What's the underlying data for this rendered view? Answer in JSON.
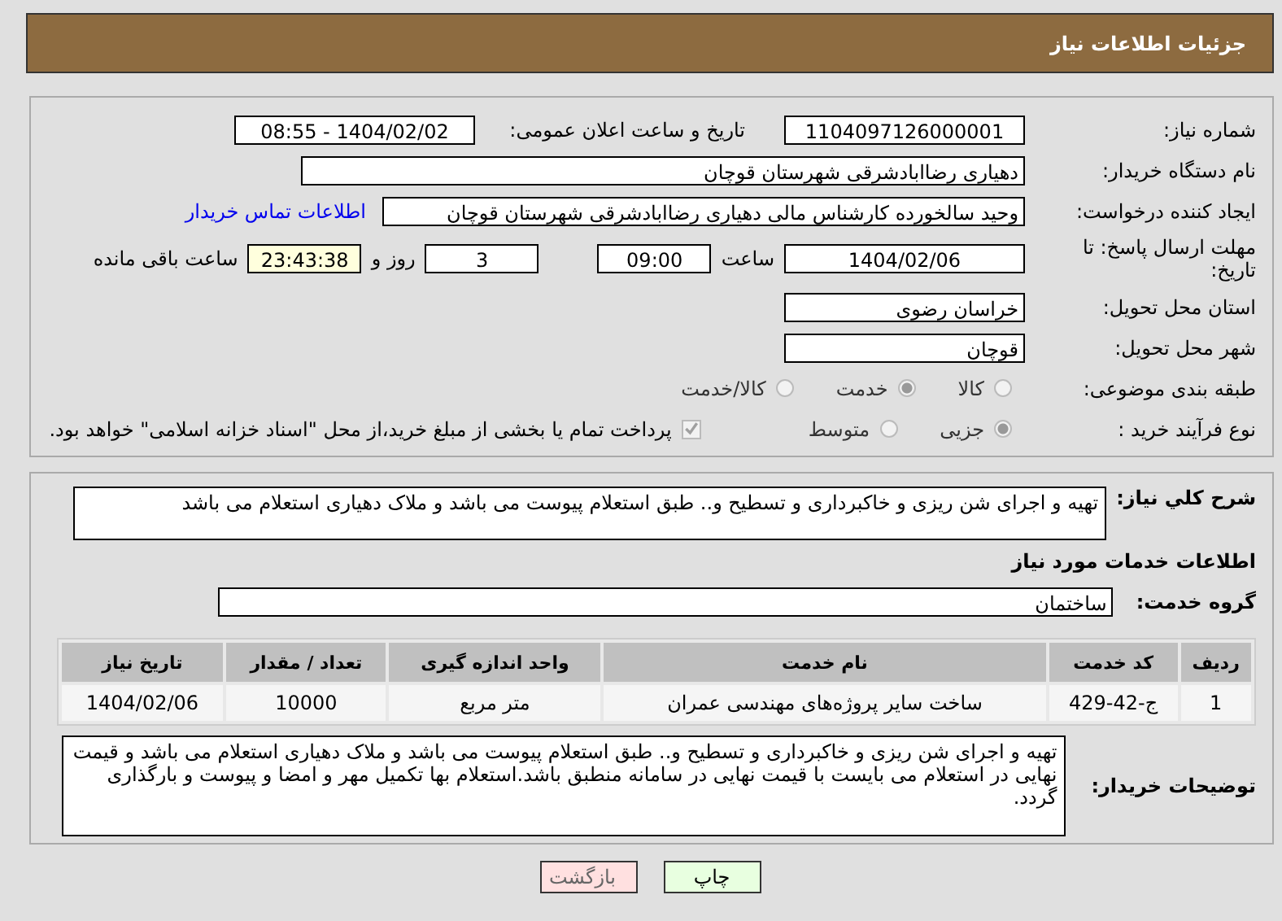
{
  "header": {
    "title": "جزئیات اطلاعات نیاز"
  },
  "need_number": {
    "label": "شماره نیاز:",
    "value": "1104097126000001"
  },
  "announce_date": {
    "label": "تاریخ و ساعت اعلان عمومی:",
    "value": "1404/02/02 - 08:55"
  },
  "buyer_org": {
    "label": "نام دستگاه خریدار:",
    "value": "دهیاری رضاابادشرقی  شهرستان قوچان"
  },
  "requester": {
    "label": "ایجاد کننده درخواست:",
    "value": "وحید سالخورده کارشناس مالی دهیاری رضاابادشرقی  شهرستان قوچان",
    "link": "اطلاعات تماس خریدار"
  },
  "deadline": {
    "label": "مهلت ارسال پاسخ: تا تاریخ:",
    "date": "1404/02/06",
    "time_label": "ساعت",
    "time": "09:00",
    "days": "3",
    "days_label": "روز و",
    "remaining": "23:43:38",
    "remaining_label": "ساعت باقی مانده"
  },
  "province": {
    "label": "استان محل تحویل:",
    "value": "خراسان رضوی"
  },
  "city": {
    "label": "شهر محل تحویل:",
    "value": "قوچان"
  },
  "category": {
    "label": "طبقه بندی موضوعی:",
    "options": [
      {
        "label": "کالا",
        "selected": false
      },
      {
        "label": "خدمت",
        "selected": true
      },
      {
        "label": "کالا/خدمت",
        "selected": false
      }
    ]
  },
  "process": {
    "label": "نوع فرآیند خرید :",
    "options": [
      {
        "label": "جزیی",
        "selected": true
      },
      {
        "label": "متوسط",
        "selected": false
      }
    ],
    "payment_checkbox": {
      "checked": true,
      "label": "پرداخت تمام یا بخشی از مبلغ خرید،از محل \"اسناد خزانه اسلامی\" خواهد بود."
    }
  },
  "summary": {
    "label": "شرح كلي نياز:",
    "value": "تهیه و اجرای شن ریزی و خاکبرداری و تسطیح و.. طبق استعلام پیوست می باشد و ملاک دهیاری استعلام می باشد"
  },
  "services_title": "اطلاعات خدمات مورد نیاز",
  "service_group": {
    "label": "گروه خدمت:",
    "value": "ساختمان"
  },
  "table": {
    "columns": [
      "ردیف",
      "کد خدمت",
      "نام خدمت",
      "واحد اندازه گیری",
      "تعداد / مقدار",
      "تاریخ نیاز"
    ],
    "rows": [
      [
        "1",
        "ج-42-429",
        "ساخت سایر پروژه‌های مهندسی عمران",
        "متر مربع",
        "10000",
        "1404/02/06"
      ]
    ]
  },
  "buyer_notes": {
    "label": "توضیحات خریدار:",
    "value": "تهیه و اجرای شن ریزی و خاکبرداری و تسطیح و.. طبق استعلام پیوست می باشد و ملاک دهیاری استعلام می باشد و قیمت نهایی در استعلام می بایست با قیمت نهایی در سامانه منطبق باشد.استعلام بها تکمیل مهر و امضا و پیوست و بارگذاری گردد."
  },
  "buttons": [
    {
      "kind": "print",
      "label": "چاپ"
    },
    {
      "kind": "back",
      "label": "بازگشت"
    }
  ]
}
